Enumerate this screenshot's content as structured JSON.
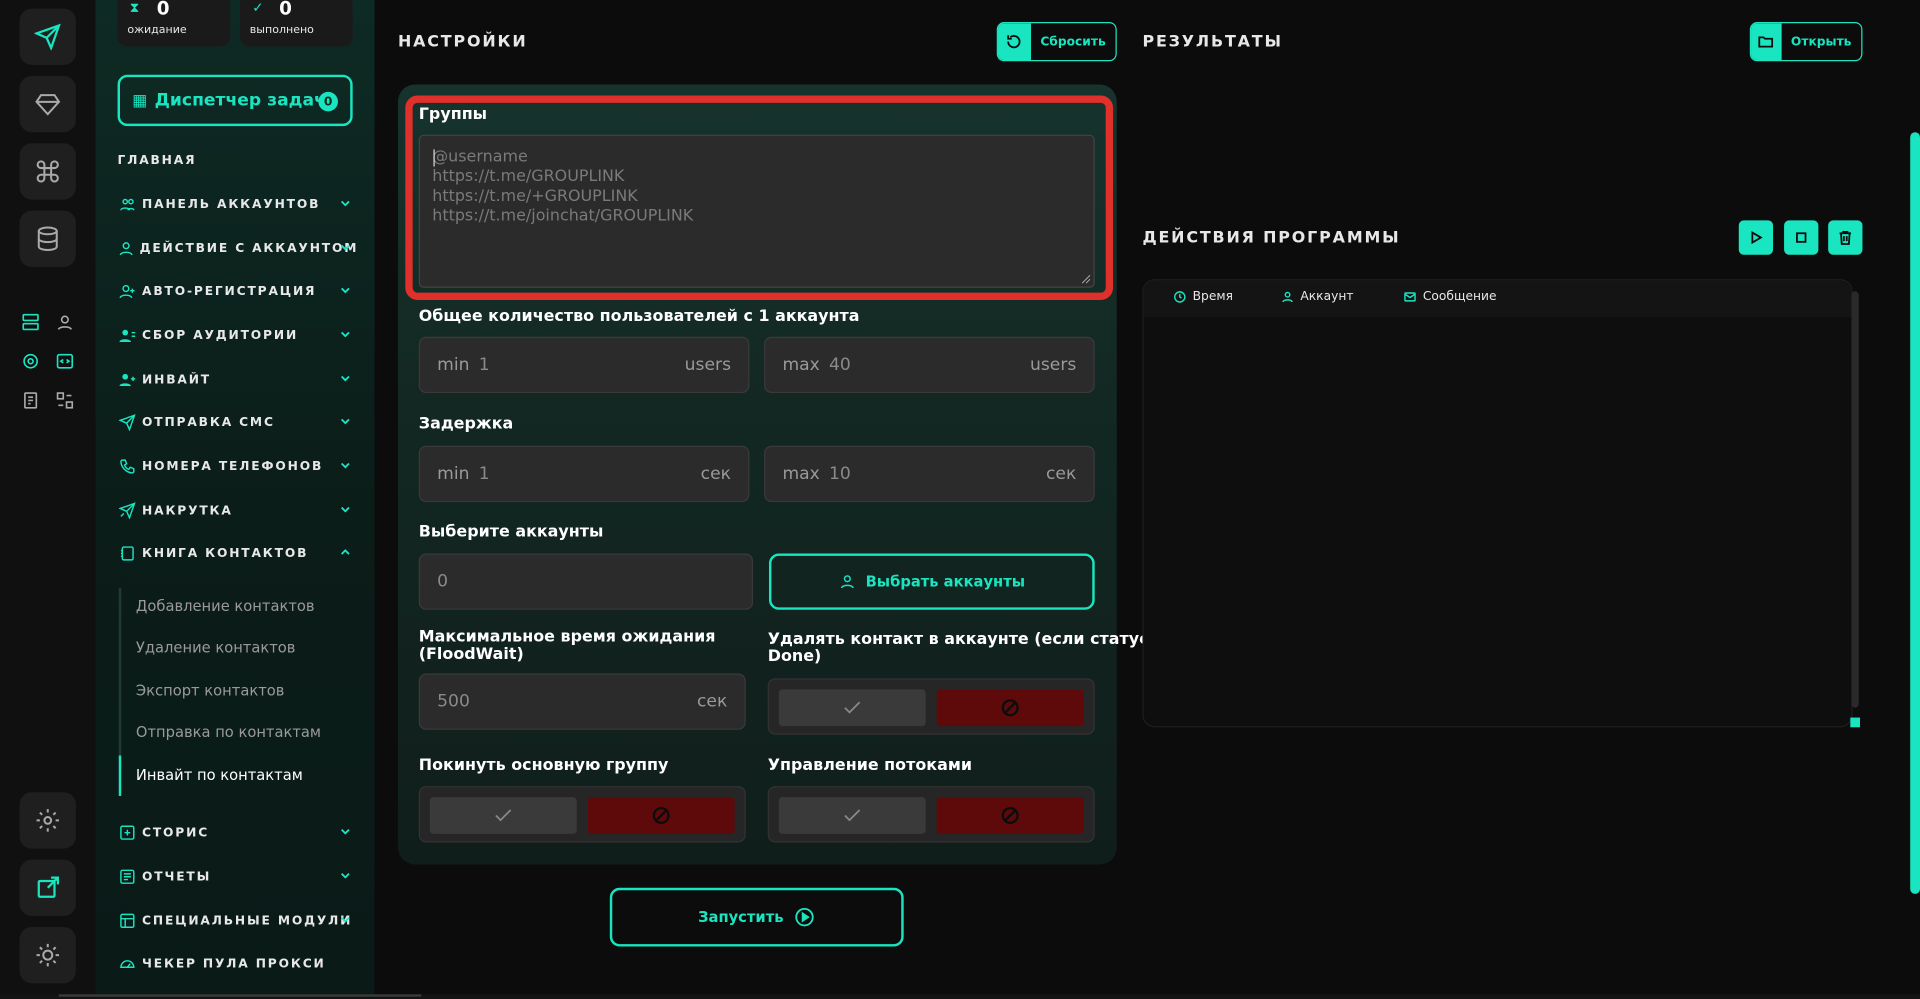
{
  "stats": {
    "waiting": {
      "count": "0",
      "label": "ожидание"
    },
    "done": {
      "count": "0",
      "label": "выполнено"
    }
  },
  "dispatcher": {
    "label": "Диспетчер задач",
    "count": "0"
  },
  "nav": {
    "header": "ГЛАВНАЯ",
    "items": [
      {
        "label": "ПАНЕЛЬ АККАУНТОВ"
      },
      {
        "label": "ДЕЙСТВИЕ С АККАУНТОМ"
      },
      {
        "label": "АВТО-РЕГИСТРАЦИЯ"
      },
      {
        "label": "СБОР АУДИТОРИИ"
      },
      {
        "label": "ИНВАЙТ"
      },
      {
        "label": "ОТПРАВКА СМС"
      },
      {
        "label": "НОМЕРА ТЕЛЕФОНОВ"
      },
      {
        "label": "НАКРУТКА"
      },
      {
        "label": "КНИГА КОНТАКТОВ"
      },
      {
        "label": "СТОРИС"
      },
      {
        "label": "ОТЧЕТЫ"
      },
      {
        "label": "СПЕЦИАЛЬНЫЕ МОДУЛИ"
      },
      {
        "label": "ЧЕКЕР ПУЛА ПРОКСИ"
      }
    ],
    "contacts_sub": [
      {
        "label": "Добавление контактов"
      },
      {
        "label": "Удаление контактов"
      },
      {
        "label": "Экспорт контактов"
      },
      {
        "label": "Отправка по контактам"
      },
      {
        "label": "Инвайт по контактам"
      }
    ]
  },
  "settings": {
    "title": "НАСТРОЙКИ",
    "reset_label": "Сбросить",
    "groups": {
      "label": "Группы",
      "placeholder": "@username\nhttps://t.me/GROUPLINK\nhttps://t.me/+GROUPLINK\nhttps://t.me/joinchat/GROUPLINK"
    },
    "users_per_account": {
      "label": "Общее количество пользователей с 1 аккаунта",
      "min_prefix": "min",
      "min_value": "1",
      "min_unit": "users",
      "max_prefix": "max",
      "max_value": "40",
      "max_unit": "users"
    },
    "delay": {
      "label": "Задержка",
      "min_prefix": "min",
      "min_value": "1",
      "min_unit": "сек",
      "max_prefix": "max",
      "max_value": "10",
      "max_unit": "сек"
    },
    "accounts": {
      "label": "Выберите аккаунты",
      "value": "0",
      "select_button": "Выбрать аккаунты"
    },
    "floodwait": {
      "label_line1": "Максимальное время ожидания",
      "label_line2": "(FloodWait)",
      "value": "500",
      "unit": "сек"
    },
    "delete_contact": {
      "label_line1": "Удалять контакт в аккаунте (если статус",
      "label_line2": "Done)"
    },
    "leave_group": {
      "label": "Покинуть основную группу"
    },
    "threads": {
      "label": "Управление потоками"
    },
    "run_label": "Запустить"
  },
  "results": {
    "title": "РЕЗУЛЬТАТЫ",
    "open_label": "Открыть"
  },
  "program_actions": {
    "title": "ДЕЙСТВИЯ ПРОГРАММЫ",
    "columns": {
      "time": "Время",
      "account": "Аккаунт",
      "message": "Сообщение"
    }
  },
  "colors": {
    "accent": "#19e6c1",
    "danger": "#5e0a0a",
    "highlight": "#e0302b"
  }
}
